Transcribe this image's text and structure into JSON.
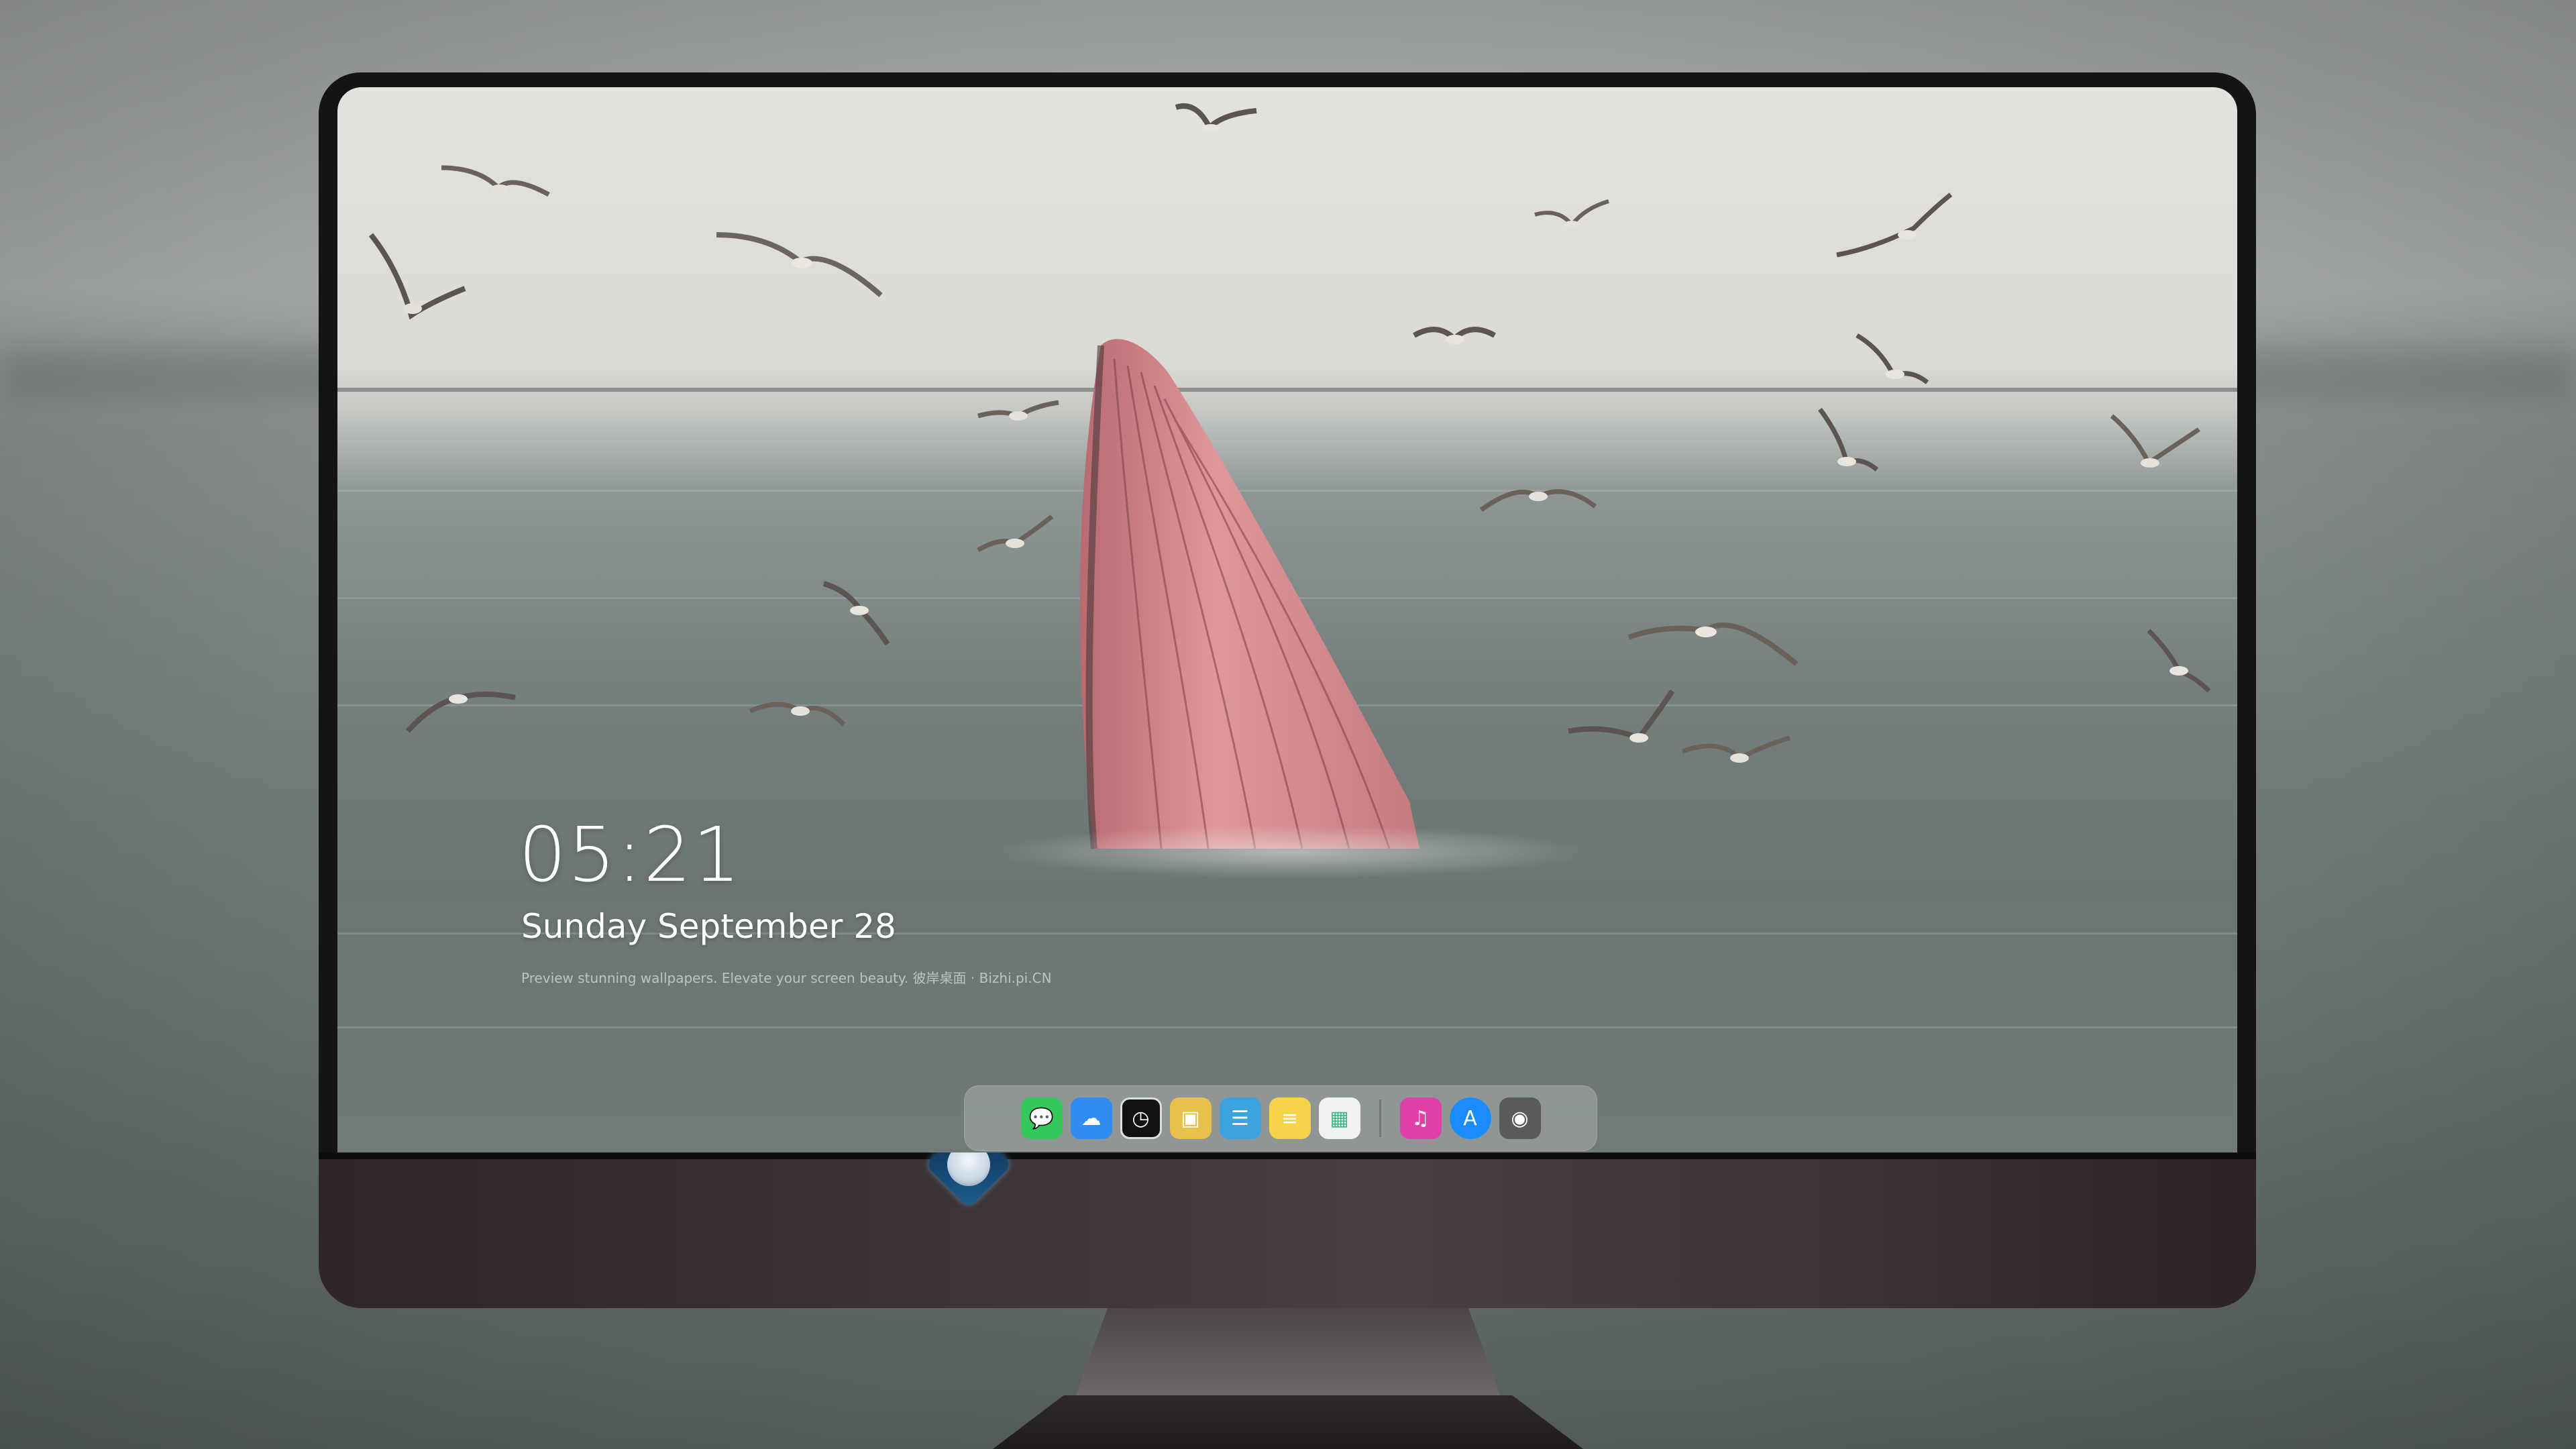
{
  "lockscreen": {
    "time": "05:21",
    "date": "Sunday September  28",
    "tagline": "Preview stunning wallpapers. Elevate your screen beauty. 彼岸桌面 · Bizhi.pi.CN"
  },
  "dock": {
    "apps": [
      {
        "name": "Messages",
        "icon": "messages-icon",
        "color": "#34c759",
        "glyph": "💬"
      },
      {
        "name": "Weather",
        "icon": "weather-icon",
        "color": "#2f8cf0",
        "glyph": "☁"
      },
      {
        "name": "Clock",
        "icon": "clock-icon",
        "color": "#111111",
        "glyph": "◷"
      },
      {
        "name": "Preview",
        "icon": "preview-icon",
        "color": "#e8c14a",
        "glyph": "▣"
      },
      {
        "name": "Final Cut",
        "icon": "clapper-icon",
        "color": "#3aa3e0",
        "glyph": "☰"
      },
      {
        "name": "Notes",
        "icon": "notes-icon",
        "color": "#f7d34a",
        "glyph": "≡"
      },
      {
        "name": "Photo Booth",
        "icon": "photos-icon",
        "color": "#f1f1f1",
        "glyph": "▦"
      },
      {
        "name": "iTunes",
        "icon": "music-icon",
        "color": "#e040a8",
        "glyph": "♫"
      },
      {
        "name": "App Store",
        "icon": "appstore-icon",
        "color": "#1a8cff",
        "glyph": "A"
      },
      {
        "name": "Camera",
        "icon": "camera-icon",
        "color": "#5a5a5a",
        "glyph": "◉"
      }
    ]
  },
  "colors": {
    "whale": "#d98b8e",
    "sea": "#76817f",
    "sky": "#e3e2dc",
    "dock_bg": "rgba(210,212,214,0.32)"
  }
}
